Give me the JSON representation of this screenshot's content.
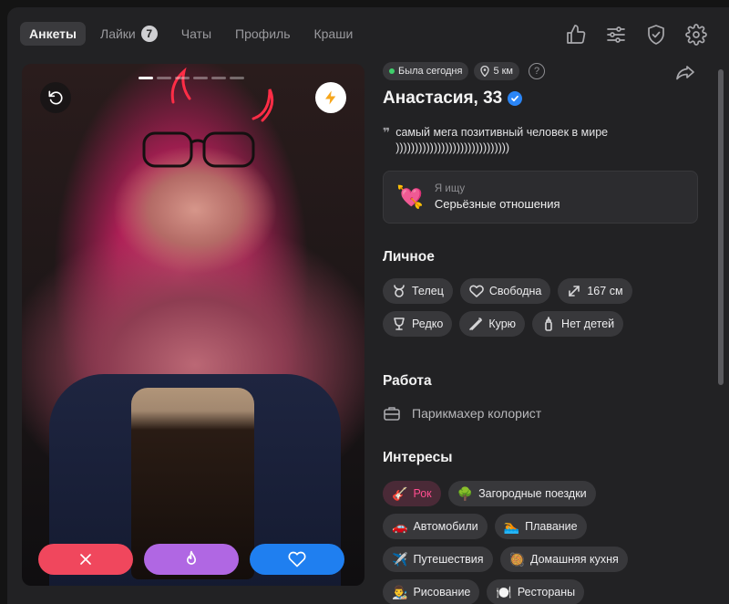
{
  "nav": {
    "tabs": [
      {
        "label": "Анкеты",
        "active": true
      },
      {
        "label": "Лайки",
        "badge": "7"
      },
      {
        "label": "Чаты"
      },
      {
        "label": "Профиль"
      },
      {
        "label": "Краши"
      }
    ],
    "icons": [
      "thumbs-up-icon",
      "filters-icon",
      "shield-check-icon",
      "gear-icon"
    ]
  },
  "photo": {
    "pages_total": 6,
    "current_page": 1,
    "undo_icon": "undo-icon",
    "boost_icon": "lightning-icon",
    "actions": [
      "close-icon",
      "fire-icon",
      "heart-icon"
    ]
  },
  "profile": {
    "last_seen": "Была сегодня",
    "distance": "5 км",
    "help": "?",
    "name": "Анастасия, 33",
    "quote": "самый мега позитивный человек в мире ))))))))))))))))))))))))))))))",
    "seeking": {
      "emoji": "💘",
      "label": "Я ищу",
      "value": "Серьёзные отношения"
    }
  },
  "personal": {
    "title": "Личное",
    "tags": [
      {
        "icon": "taurus-icon",
        "label": "Телец"
      },
      {
        "icon": "heart-outline-icon",
        "label": "Свободна"
      },
      {
        "icon": "height-icon",
        "label": "167 см"
      },
      {
        "icon": "wine-glass-icon",
        "label": "Редко"
      },
      {
        "icon": "cigarette-icon",
        "label": "Курю"
      },
      {
        "icon": "baby-bottle-icon",
        "label": "Нет детей"
      }
    ]
  },
  "work": {
    "title": "Работа",
    "value": "Парикмахер колорист",
    "icon": "briefcase-icon"
  },
  "interests": {
    "title": "Интересы",
    "tags": [
      {
        "emoji": "🎸",
        "label": "Рок",
        "highlight": true
      },
      {
        "emoji": "🌳",
        "label": "Загородные поездки"
      },
      {
        "emoji": "🚗",
        "label": "Автомобили"
      },
      {
        "emoji": "🏊",
        "label": "Плавание"
      },
      {
        "emoji": "✈️",
        "label": "Путешествия"
      },
      {
        "emoji": "🥘",
        "label": "Домашняя кухня"
      },
      {
        "emoji": "👨‍🎨",
        "label": "Рисование"
      },
      {
        "emoji": "🍽️",
        "label": "Рестораны"
      }
    ]
  },
  "colors": {
    "accent_pink": "#ff4d8f",
    "dislike": "#f0475d",
    "super": "#b067e3",
    "like": "#1f7ff0",
    "online": "#3fcf6b"
  }
}
